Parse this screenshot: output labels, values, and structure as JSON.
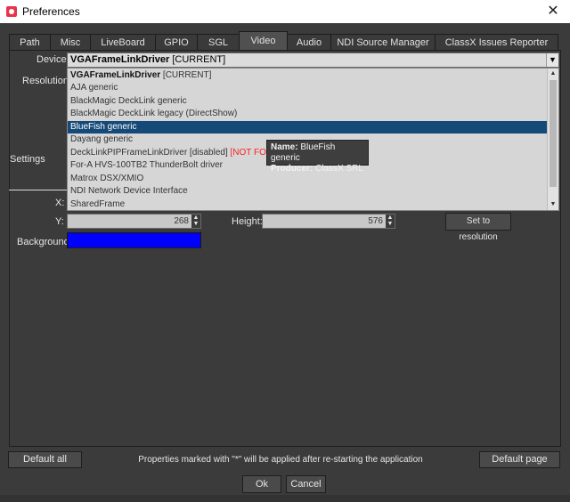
{
  "window": {
    "title": "Preferences",
    "close_glyph": "✕",
    "app_icon": "app-logo-icon"
  },
  "tabs": [
    {
      "label": "Path",
      "active": false
    },
    {
      "label": "Misc",
      "active": false
    },
    {
      "label": "LiveBoard",
      "active": false
    },
    {
      "label": "GPIO",
      "active": false
    },
    {
      "label": "SGL",
      "active": false
    },
    {
      "label": "Video",
      "active": true
    },
    {
      "label": "Audio",
      "active": false
    },
    {
      "label": "NDI Source Manager",
      "active": false
    },
    {
      "label": "ClassX Issues Reporter",
      "active": false
    }
  ],
  "video": {
    "device_label": "Device:",
    "device_value": "VGAFrameLinkDriver",
    "device_value_suffix": " [CURRENT]",
    "resolution_label": "Resolution:",
    "settings_label": "Settings",
    "x_label": "X:",
    "y_label": "Y:",
    "y_value": "268",
    "height_label": "Height:",
    "height_value": "576",
    "set_resolution_button": "Set to resolution",
    "background_label": "Background:",
    "background_color": "#0000FF"
  },
  "dropdown": {
    "items": [
      {
        "text": "VGAFrameLinkDriver",
        "suffix": " [CURRENT]",
        "state": "current"
      },
      {
        "text": "AJA generic",
        "state": "normal"
      },
      {
        "text": "BlackMagic DeckLink generic",
        "state": "normal"
      },
      {
        "text": "BlackMagic DeckLink legacy (DirectShow)",
        "state": "normal"
      },
      {
        "text": "BlueFish generic",
        "state": "selected"
      },
      {
        "text": "Dayang generic",
        "state": "normal"
      },
      {
        "text": "DeckLinkPIPFrameLinkDriver [disabled]",
        "suffix": "[NOT FOUND",
        "state": "disabled"
      },
      {
        "text": "For-A HVS-100TB2 ThunderBolt driver",
        "state": "normal"
      },
      {
        "text": "Matrox DSX/XMIO",
        "state": "normal"
      },
      {
        "text": "NDI Network Device Interface",
        "state": "normal"
      },
      {
        "text": "SharedFrame",
        "state": "normal"
      }
    ]
  },
  "tooltip": {
    "name_label": "Name:",
    "name_value": "BlueFish generic",
    "producer_label": "Producer:",
    "producer_value": "ClassX SRL"
  },
  "footer": {
    "default_all_button": "Default all",
    "note": "Properties marked with \"*\" will be applied after re-starting the application",
    "default_page_button": "Default page",
    "ok_button": "Ok",
    "cancel_button": "Cancel"
  }
}
